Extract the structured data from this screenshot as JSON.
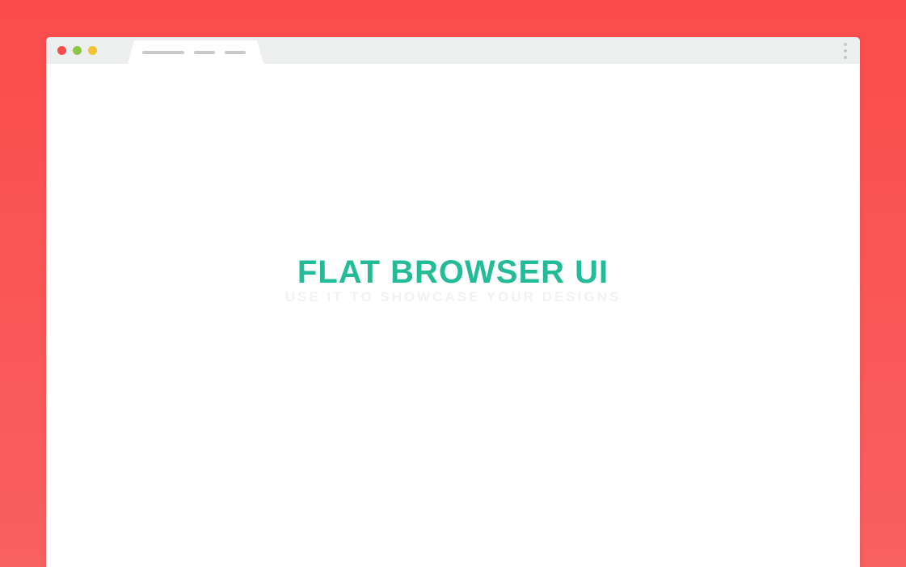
{
  "content": {
    "headline": "FLAT BROWSER UI",
    "subheadline": "USE IT TO SHOWCASE YOUR DESIGNS"
  },
  "colors": {
    "background": "#fa4c4c",
    "accent": "#23bb98",
    "chrome": "#edeeee"
  }
}
